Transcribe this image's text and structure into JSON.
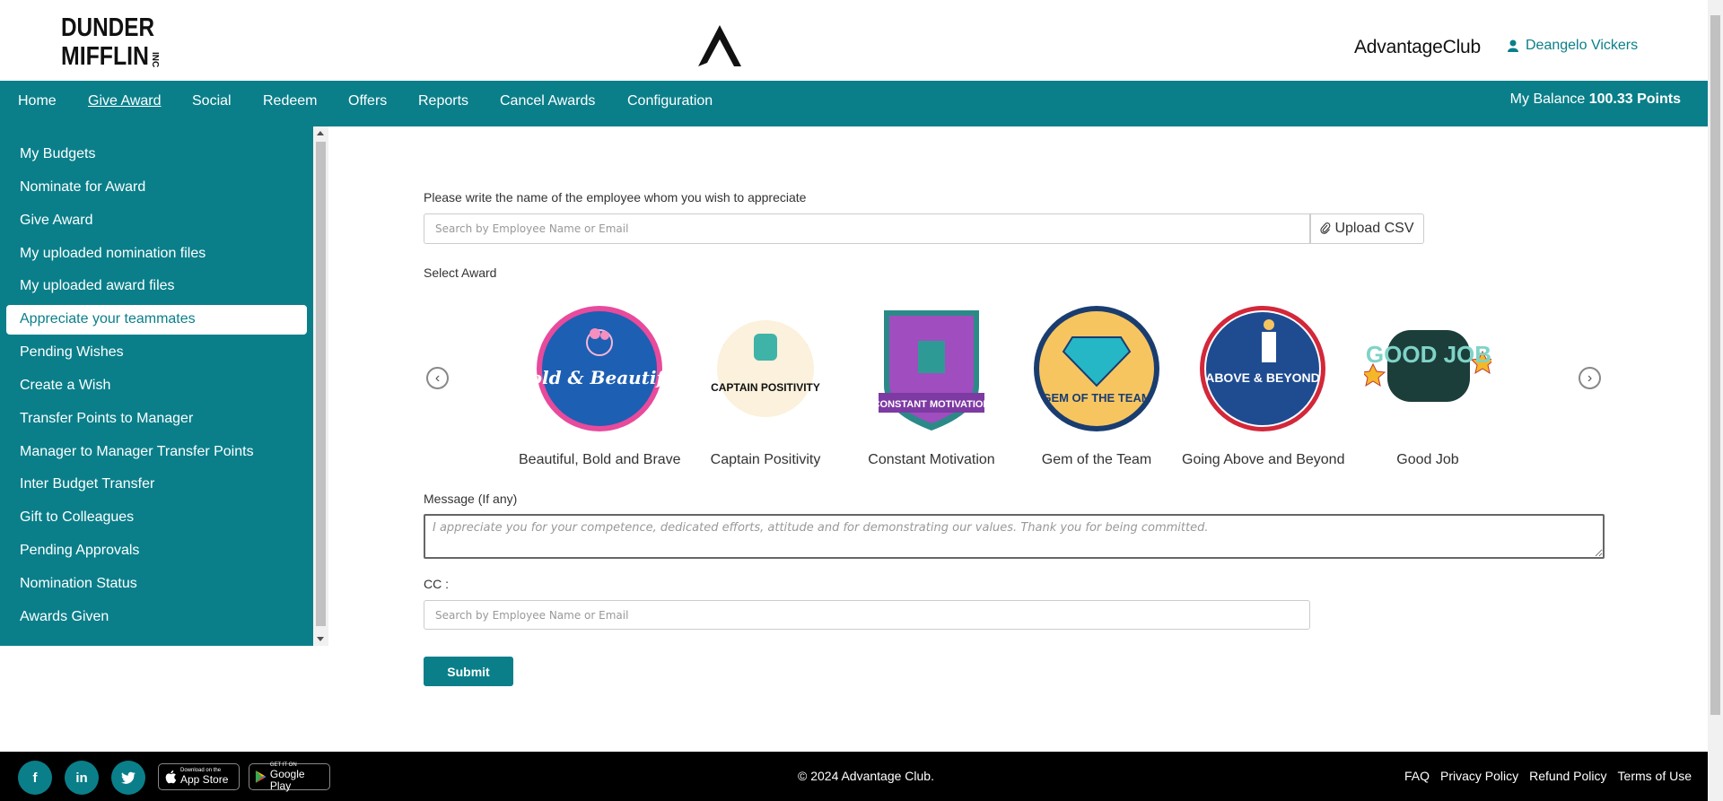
{
  "header": {
    "brand_logo_text": "DUNDER MIFFLIN INC",
    "brand_name": "AdvantageClub",
    "user_name": "Deangelo Vickers"
  },
  "nav": {
    "items": [
      "Home",
      "Give Award",
      "Social",
      "Redeem",
      "Offers",
      "Reports",
      "Cancel Awards",
      "Configuration"
    ],
    "active": "Give Award",
    "balance_label": "My Balance",
    "balance_value": "100.33 Points"
  },
  "sidebar": {
    "items": [
      "My Budgets",
      "Nominate for Award",
      "Give Award",
      "My uploaded nomination files",
      "My uploaded award files",
      "Appreciate your teammates",
      "Pending Wishes",
      "Create a Wish",
      "Transfer Points to Manager",
      "Manager to Manager Transfer Points",
      "Inter Budget Transfer",
      "Gift to Colleagues",
      "Pending Approvals",
      "Nomination Status",
      "Awards Given"
    ],
    "active": "Appreciate your teammates"
  },
  "form": {
    "employee_label": "Please write the name of the employee whom you wish to appreciate",
    "employee_placeholder": "Search by Employee Name or Email",
    "upload_label": "Upload CSV",
    "select_award_label": "Select Award",
    "awards": [
      {
        "name": "Beautiful, Bold and Brave",
        "badge_text": "Bold & Beautiful"
      },
      {
        "name": "Captain Positivity",
        "badge_text": "CAPTAIN POSITIVITY"
      },
      {
        "name": "Constant Motivation",
        "badge_text": "CONSTANT MOTIVATION"
      },
      {
        "name": "Gem of the Team",
        "badge_text": "GEM OF THE TEAM"
      },
      {
        "name": "Going Above and Beyond",
        "badge_text": "ABOVE & BEYOND"
      },
      {
        "name": "Good Job",
        "badge_text": "GOOD JOB"
      }
    ],
    "message_label": "Message (If any)",
    "message_placeholder": "I appreciate you for your competence, dedicated efforts, attitude and for demonstrating our values. Thank you for being committed.",
    "cc_label": "CC :",
    "cc_placeholder": "Search by Employee Name or Email",
    "submit_label": "Submit"
  },
  "footer": {
    "copyright": "© 2024 Advantage Club.",
    "links": [
      "FAQ",
      "Privacy Policy",
      "Refund Policy",
      "Terms of Use"
    ],
    "app_store_small": "Download on the",
    "app_store_big": "App Store",
    "play_store_small": "GET IT ON",
    "play_store_big": "Google Play"
  },
  "colors": {
    "primary": "#0a7f8a",
    "footer_bg": "#000000"
  }
}
